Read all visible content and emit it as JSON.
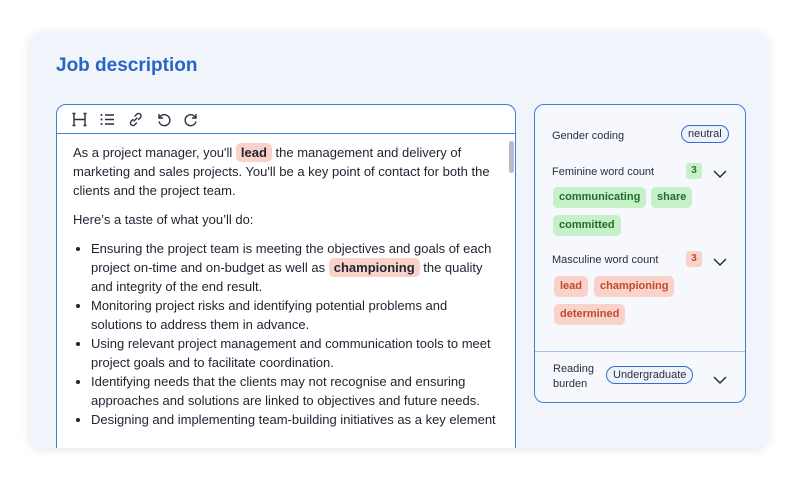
{
  "page_title": "Job description",
  "toolbar": {
    "heading_icon": "heading-icon",
    "list_icon": "bullet-list-icon",
    "link_icon": "link-icon",
    "undo_icon": "undo-icon",
    "redo_icon": "redo-icon"
  },
  "editor": {
    "p1_before": "As a project manager, you'll ",
    "p1_highlight": "lead",
    "p1_after": " the management and delivery of marketing and sales projects. You'll be a key point of contact for both the clients and the project team.",
    "p2": "Here’s a taste of what you’ll do:",
    "b1_before": "Ensuring the project team is meeting the objectives and goals of each project on-time and on-budget as well as ",
    "b1_highlight": "championing",
    "b1_after": " the quality and integrity of the end result.",
    "b2": "Monitoring project risks and identifying potential problems and solutions to address them in advance.",
    "b3": "Using relevant project management and communication tools to meet project goals and to facilitate coordination.",
    "b4": "Identifying needs that the clients may not recognise and ensuring approaches and solutions are linked to objectives and future needs.",
    "b5": "Designing and implementing team-building initiatives as a key element"
  },
  "panel": {
    "gender_coding_label": "Gender coding",
    "gender_coding_value": "neutral",
    "feminine_label": "Feminine word count",
    "feminine_count": "3",
    "feminine_words": [
      "communicating",
      "share",
      "committed"
    ],
    "masculine_label": "Masculine word count",
    "masculine_count": "3",
    "masculine_words": [
      "lead",
      "championing",
      "determined"
    ],
    "reading_label_line1": "Reading",
    "reading_label_line2": "burden",
    "reading_value": "Undergraduate"
  },
  "colors": {
    "accent": "#2667c4",
    "border": "#3b7fd8",
    "highlight_red": "#f9d2c9",
    "highlight_green": "#c5f0c8"
  }
}
